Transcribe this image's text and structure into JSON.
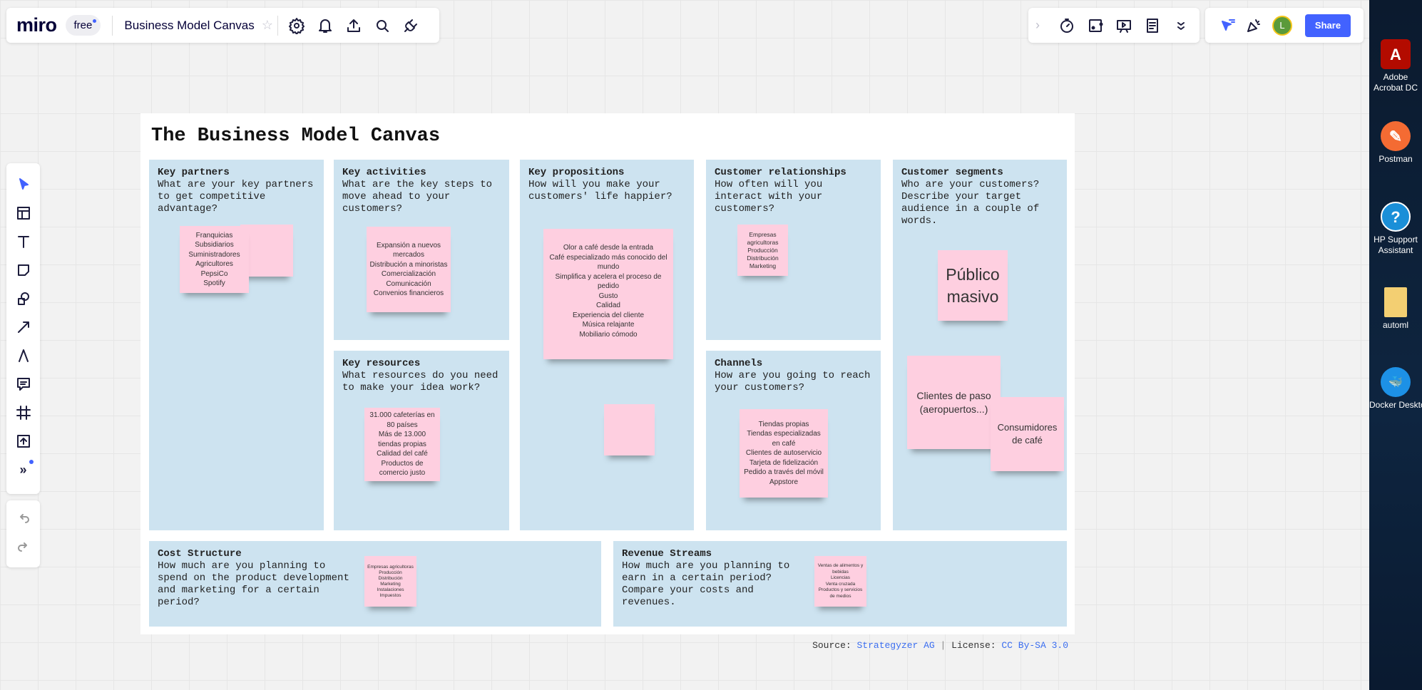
{
  "topbar": {
    "logo": "miro",
    "plan": "free",
    "board_title": "Business Model Canvas",
    "share": "Share",
    "avatar_initial": "L"
  },
  "canvas": {
    "title": "The Business Model Canvas",
    "cells": {
      "key_partners": {
        "title": "Key partners",
        "desc": "What are your key partners to get competitive advantage?"
      },
      "key_activities": {
        "title": "Key activities",
        "desc": "What are the key steps to move ahead to your customers?"
      },
      "key_resources": {
        "title": "Key resources",
        "desc": "What resources do you need to make your idea work?"
      },
      "key_propositions": {
        "title": "Key propositions",
        "desc": "How will you make your customers' life happier?"
      },
      "customer_relationships": {
        "title": "Customer relationships",
        "desc": "How often will you interact with your customers?"
      },
      "channels": {
        "title": "Channels",
        "desc": "How are you going to reach your customers?"
      },
      "customer_segments": {
        "title": "Customer segments",
        "desc": "Who are your customers? Describe your target audience in a couple of words."
      },
      "cost_structure": {
        "title": "Cost Structure",
        "desc": "How much are you planning to spend on the product development and marketing for a certain period?"
      },
      "revenue_streams": {
        "title": "Revenue Streams",
        "desc": "How much are you planning to earn in a certain period? Compare your costs and revenues."
      }
    },
    "notes": {
      "kp": "Franquicias\nSubsidiarios\nSuministradores\nAgricultores\nPepsiCo\nSpotify",
      "ka": "Expansión a nuevos mercados\nDistribución a minoristas\nComercialización\nComunicación\nConvenios financieros",
      "kprop": "Olor a café desde la entrada\nCafé especializado más conocido del mundo\nSimplifica y acelera el proceso de pedido\nGusto\nCalidad\nExperiencia del cliente\nMúsica relajante\nMobiliario cómodo",
      "cr": "Empresas agricultoras\nProducción\nDistribución\nMarketing",
      "kr": "31.000 cafeterías en 80 países\nMás de 13.000 tiendas propias\nCalidad del café\nProductos de comercio justo",
      "ch": "Tiendas propias\nTiendas especializadas en café\nClientes de autoservicio\nTarjeta de fidelización\nPedido a través del móvil\nAppstore",
      "cs1": "Público masivo",
      "cs2": "Clientes de paso (aeropuertos...)",
      "cs3": "Consumidores de café",
      "cost": "Empresas agricultoras\nProducción\nDistribución\nMarketing\nInstalaciones\nImpuestos",
      "rev": "Ventas de alimentos y bebidas\nLicencias\nVenta cruzada\nProductos y servicios de medios"
    },
    "footer": {
      "source_label": "Source:",
      "source_link": "Strategyzer AG",
      "sep": "|",
      "license_label": "License:",
      "license_link": "CC By-SA 3.0"
    }
  },
  "desktop": {
    "icons": [
      "Adobe Acrobat DC",
      "Postman",
      "HP Support Assistant",
      "automl",
      "Docker Desktop"
    ]
  }
}
